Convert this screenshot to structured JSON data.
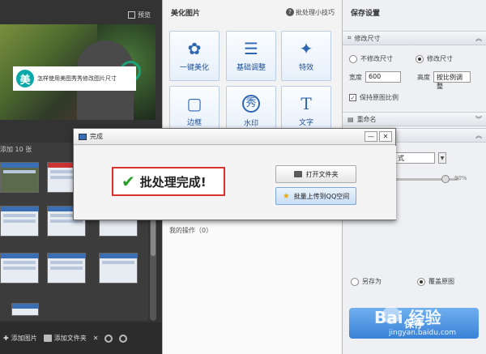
{
  "left": {
    "preview_label": "预览",
    "banner_text": "怎样使用美图秀秀修改图片尺寸",
    "banner_logo": "美",
    "count_label": "添加 10 张",
    "bottom": {
      "add_image": "添加图片",
      "add_folder": "添加文件夹"
    }
  },
  "middle": {
    "title": "美化图片",
    "tips_label": "批处理小技巧",
    "tools": [
      {
        "label": "一键美化",
        "icon": "tulip-icon"
      },
      {
        "label": "基础调整",
        "icon": "sliders-icon"
      },
      {
        "label": "特效",
        "icon": "magic-wand-icon"
      },
      {
        "label": "边框",
        "icon": "frame-icon"
      },
      {
        "label": "水印",
        "icon": "watermark-icon"
      },
      {
        "label": "文字",
        "icon": "text-icon"
      }
    ],
    "tool_glyphs": [
      "✿",
      "☰",
      "✦",
      "▢",
      "秀",
      "T"
    ],
    "ops_label": "我的操作（0）"
  },
  "right": {
    "title": "保存设置",
    "resize_section": "修改尺寸",
    "no_resize": "不修改尺寸",
    "resize": "修改尺寸",
    "width_label": "宽度",
    "width_value": "600",
    "height_label": "高度",
    "height_value": "按比例调整",
    "keep_ratio": "保持原图比例",
    "rename_section": "重命名",
    "format_value": "式",
    "quality_value": "90%",
    "save_as": "另存为",
    "overwrite": "覆盖原图",
    "save_button": "保存"
  },
  "modal": {
    "title": "完成",
    "message": "批处理完成!",
    "open_folder": "打开文件夹",
    "upload_qq": "批量上传到QQ空间",
    "minimize": "—",
    "close": "✕"
  },
  "watermark": {
    "main": "Bai  经验",
    "sub": "jingyan.baidu.com"
  },
  "colors": {
    "accent_blue": "#3a82d8",
    "highlight_red": "#d93030",
    "success_green": "#2a9a2a"
  }
}
